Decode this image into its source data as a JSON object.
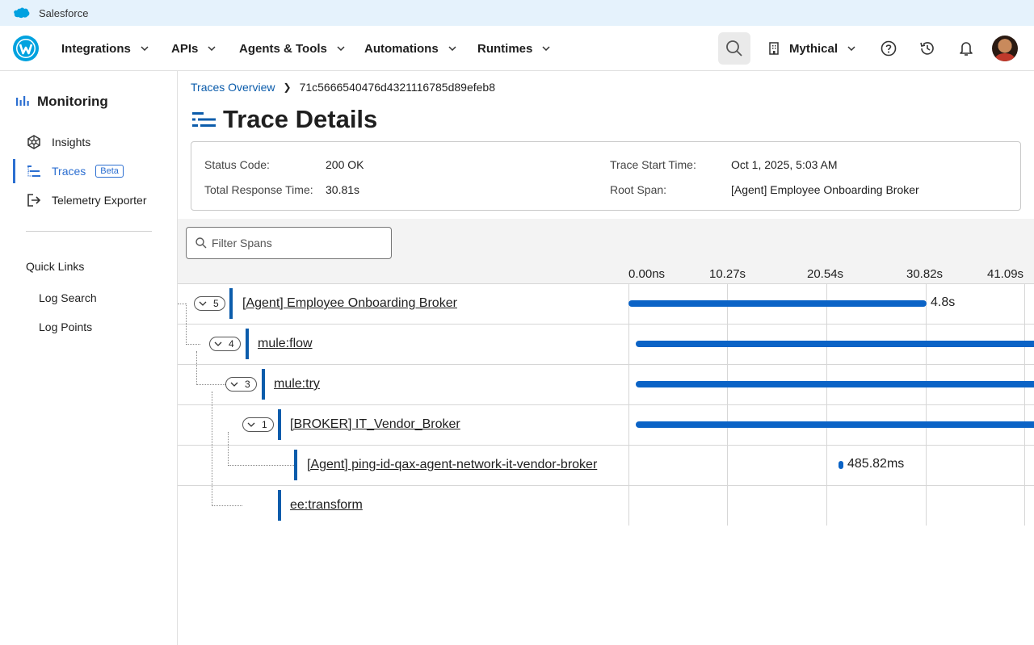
{
  "salesforce": {
    "label": "Salesforce"
  },
  "nav": {
    "items": [
      "Integrations",
      "APIs",
      "Agents & Tools",
      "Automations",
      "Runtimes"
    ],
    "org": "Mythical"
  },
  "sidebar": {
    "title": "Monitoring",
    "items": [
      {
        "label": "Insights"
      },
      {
        "label": "Traces",
        "badge": "Beta"
      },
      {
        "label": "Telemetry Exporter"
      }
    ],
    "quick_links_title": "Quick Links",
    "quick_links": [
      "Log Search",
      "Log Points"
    ]
  },
  "breadcrumb": {
    "link": "Traces Overview",
    "current": "71c5666540476d4321116785d89efeb8"
  },
  "page_title": "Trace Details",
  "details": {
    "status_code_label": "Status Code:",
    "status_code": "200 OK",
    "total_response_label": "Total Response Time:",
    "total_response": "30.81s",
    "trace_start_label": "Trace Start Time:",
    "trace_start": "Oct 1, 2025, 5:03 AM",
    "root_span_label": "Root Span:",
    "root_span": "[Agent] Employee Onboarding Broker"
  },
  "filter": {
    "placeholder": "Filter Spans"
  },
  "timeline": {
    "ticks": [
      "0.00ns",
      "10.27s",
      "20.54s",
      "30.82s",
      "41.09s"
    ],
    "spans": [
      {
        "name": "[Agent] Employee Onboarding Broker",
        "count": "5",
        "duration": "4.8s"
      },
      {
        "name": "mule:flow",
        "count": "4",
        "duration": ""
      },
      {
        "name": "mule:try",
        "count": "3",
        "duration": ""
      },
      {
        "name": "[BROKER] IT_Vendor_Broker",
        "count": "1",
        "duration": ""
      },
      {
        "name": "[Agent] ping-id-qax-agent-network-it-vendor-broker",
        "count": "",
        "duration": "485.82ms"
      },
      {
        "name": "ee:transform",
        "count": "",
        "duration": ""
      }
    ]
  },
  "colors": {
    "accent": "#0b5cab",
    "bar": "#0b63c6",
    "nav_active": "#2c6fd1"
  }
}
